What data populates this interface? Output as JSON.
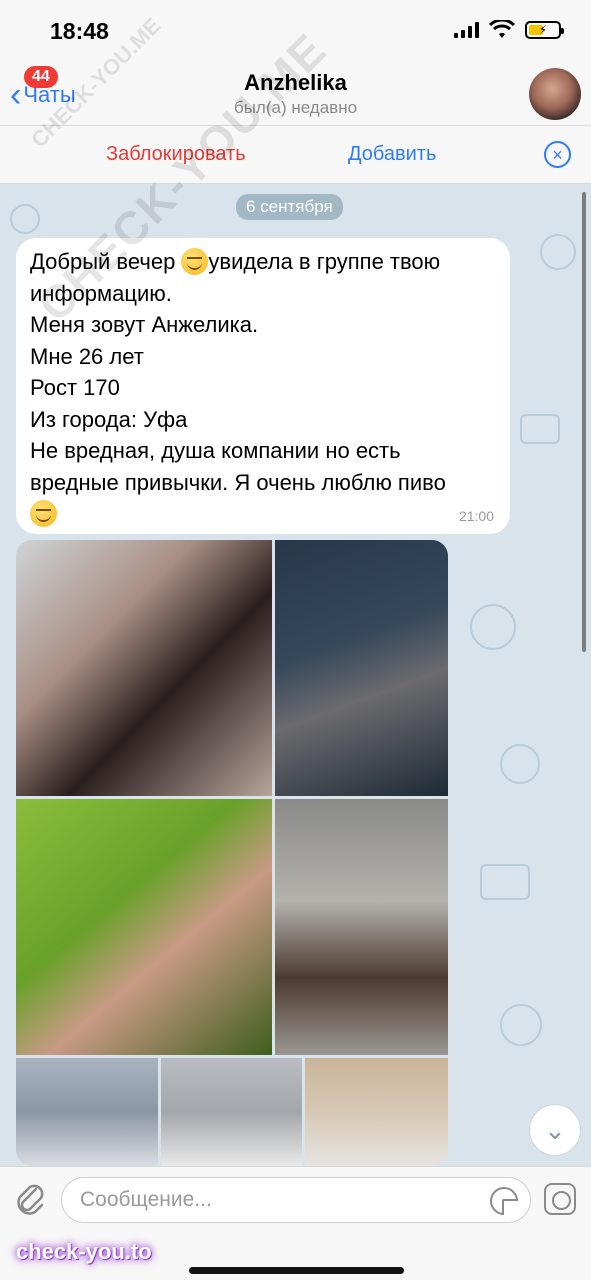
{
  "status": {
    "time": "18:48"
  },
  "nav": {
    "badge": "44",
    "back_label": "Чаты",
    "title": "Anzhelika",
    "subtitle": "был(а) недавно"
  },
  "actions": {
    "block_label": "Заблокировать",
    "add_label": "Добавить"
  },
  "chat": {
    "date": "6 сентября",
    "message": {
      "lines": [
        {
          "before": "Добрый вечер ",
          "emoji": "smiling-face-icon",
          "after": "увидела в группе твою"
        },
        "информацию.",
        "Меня зовут Анжелика.",
        "Мне 26 лет",
        "Рост 170",
        "Из города: Уфа",
        "Не вредная, душа компании но есть",
        "вредные привычки. Я очень люблю пиво"
      ],
      "time": "21:00"
    }
  },
  "composer": {
    "placeholder": "Сообщение..."
  },
  "watermarks": {
    "bottom": "check-you.to",
    "diagonal": "CHECK-YOU.ME",
    "small": "CHECK-YOU.ME"
  },
  "colors": {
    "accent": "#2f7bf5",
    "danger": "#e53935",
    "badge": "#ef3b36",
    "chat_bg": "#d8e3ec"
  }
}
